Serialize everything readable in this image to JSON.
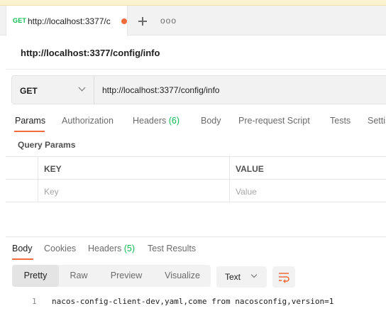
{
  "tab": {
    "method": "GET",
    "title": "http://localhost:3377/c",
    "unsaved_dot_color": "#f26b3a",
    "new_tab_icon": "plus-icon",
    "more_icon": "ellipsis-icon",
    "more_label": "ooo"
  },
  "request": {
    "title": "http://localhost:3377/config/info",
    "method": "GET",
    "url": "http://localhost:3377/config/info"
  },
  "request_tabs": [
    {
      "label": "Params",
      "active": true
    },
    {
      "label": "Authorization"
    },
    {
      "label": "Headers",
      "count": "(6)"
    },
    {
      "label": "Body"
    },
    {
      "label": "Pre-request Script"
    },
    {
      "label": "Tests"
    },
    {
      "label": "Setti"
    }
  ],
  "query_params": {
    "title": "Query Params",
    "columns": [
      "KEY",
      "VALUE"
    ],
    "placeholders": [
      "Key",
      "Value"
    ]
  },
  "response_tabs": [
    {
      "label": "Body",
      "active": true
    },
    {
      "label": "Cookies"
    },
    {
      "label": "Headers",
      "count": "(5)"
    },
    {
      "label": "Test Results"
    }
  ],
  "format_buttons": [
    "Pretty",
    "Raw",
    "Preview",
    "Visualize"
  ],
  "active_format": "Pretty",
  "language": "Text",
  "wrap_icon": "wrap-lines-icon",
  "response_body": {
    "line_number": "1",
    "text": "nacos-config-client-dev,yaml,come from nacosconfig,version=1"
  },
  "colors": {
    "accent": "#f26b3a",
    "count": "#0cbb52",
    "get_method": "#0cbb52"
  }
}
